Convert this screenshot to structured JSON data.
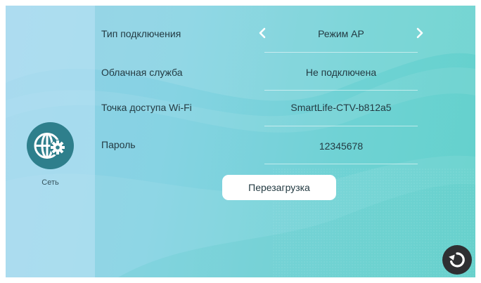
{
  "sidebar": {
    "items": [
      {
        "label": "Сеть",
        "icon": "globe-gear-icon"
      }
    ]
  },
  "settings": {
    "connection_type": {
      "label": "Тип подключения",
      "value": "Режим AP"
    },
    "cloud_service": {
      "label": "Облачная служба",
      "value": "Не подключена"
    },
    "wifi_access_point": {
      "label": "Точка доступа Wi-Fi",
      "value": "SmartLife-CTV-b812a5"
    },
    "password": {
      "label": "Пароль",
      "value": "12345678"
    }
  },
  "actions": {
    "reboot_label": "Перезагрузка",
    "back_icon": "back-arrow-icon"
  },
  "colors": {
    "accent": "#2e7f8c",
    "button_bg": "#ffffff",
    "back_button_bg": "#2e2f32"
  }
}
